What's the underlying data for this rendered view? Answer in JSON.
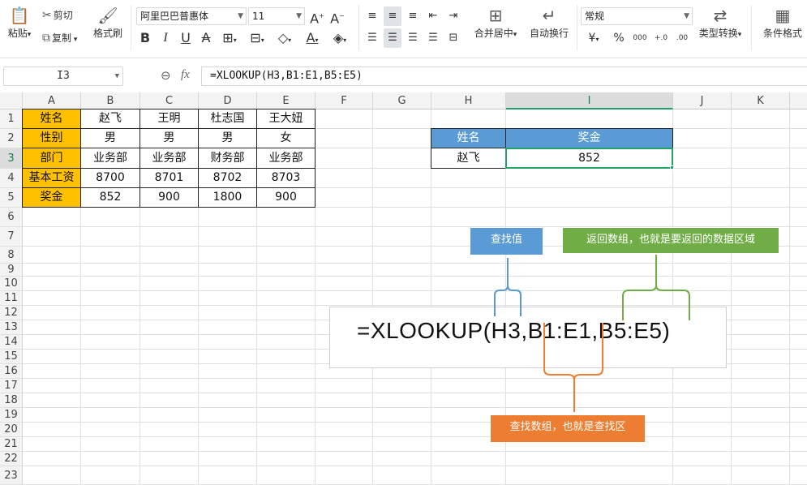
{
  "ribbon": {
    "paste": "粘贴",
    "cut": "剪切",
    "copy": "复制",
    "format_painter": "格式刷",
    "font_name": "阿里巴巴普惠体",
    "font_size": "11",
    "merge_center": "合并居中",
    "auto_wrap": "自动换行",
    "number_format": "常规",
    "type_convert": "类型转换",
    "cond_format": "条件格式"
  },
  "formula_bar": {
    "cell_ref": "I3",
    "formula": "=XLOOKUP(H3,B1:E1,B5:E5)"
  },
  "columns": [
    "A",
    "B",
    "C",
    "D",
    "E",
    "F",
    "G",
    "H",
    "I",
    "J",
    "K"
  ],
  "rows": [
    "1",
    "2",
    "3",
    "4",
    "5",
    "6",
    "7",
    "8",
    "9",
    "10",
    "11",
    "12",
    "13",
    "14",
    "15",
    "16",
    "17",
    "18",
    "19",
    "20",
    "21",
    "22",
    "23"
  ],
  "table": {
    "row1": [
      "姓名",
      "赵飞",
      "王明",
      "杜志国",
      "王大妞"
    ],
    "row2": [
      "性别",
      "男",
      "男",
      "男",
      "女"
    ],
    "row3": [
      "部门",
      "业务部",
      "业务部",
      "财务部",
      "业务部"
    ],
    "row4": [
      "基本工资",
      "8700",
      "8701",
      "8702",
      "8703"
    ],
    "row5": [
      "奖金",
      "852",
      "900",
      "1800",
      "900"
    ]
  },
  "lookup": {
    "h_header": "姓名",
    "i_header": "奖金",
    "h_value": "赵飞",
    "i_value": "852"
  },
  "callouts": {
    "lookup_value": "查找值",
    "return_array": "返回数组，也就是要返回的数据区域",
    "lookup_array": "查找数组，也就是查找区"
  },
  "formula_display": "=XLOOKUP(H3,B1:E1,B5:E5)",
  "colors": {
    "header_fill": "#ffc000",
    "lookup_header_fill": "#5b9bd5",
    "callout_blue": "#5b9bd5",
    "callout_green": "#70ad47",
    "callout_orange": "#ed7d31",
    "selection": "#21a366"
  }
}
